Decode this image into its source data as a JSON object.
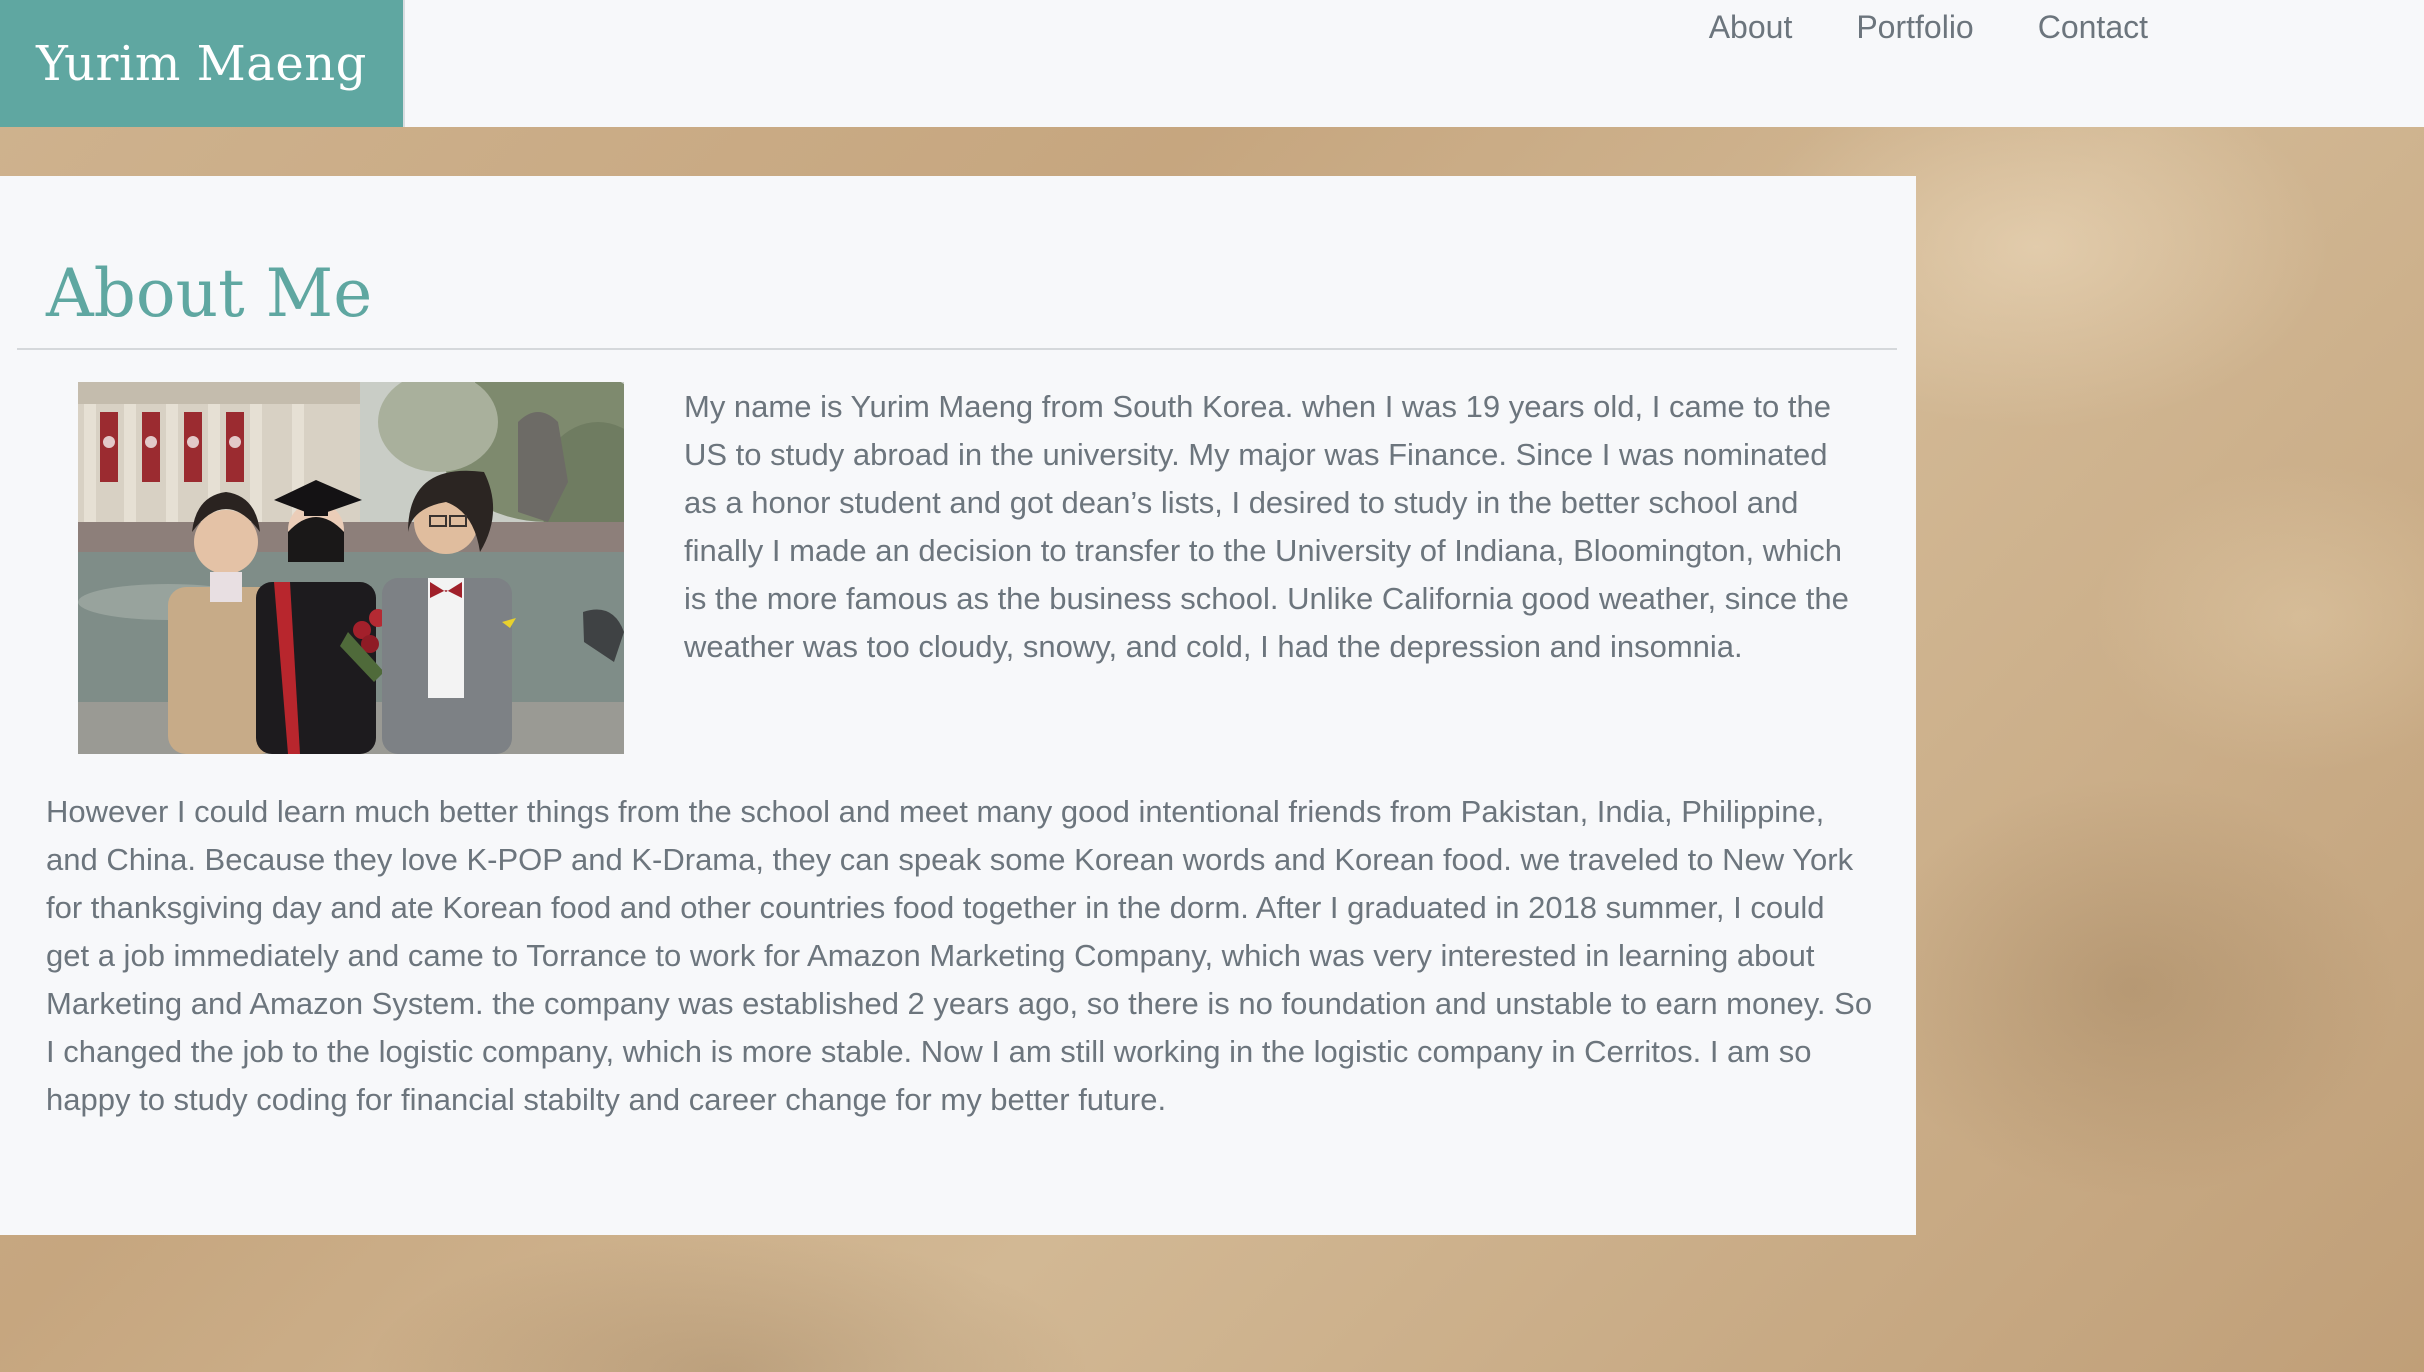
{
  "header": {
    "brand": "Yurim Maeng",
    "nav": [
      "About",
      "Portfolio",
      "Contact"
    ]
  },
  "about": {
    "title": "About Me",
    "photo_icon": "graduation-family-photo",
    "paragraph_1": "My name is Yurim Maeng from South Korea. when I was 19 years old, I came to the US to study abroad in the university. My major was Finance. Since I was nominated as a honor student and got dean’s lists, I desired to study in the better school and finally I made an decision to transfer to the University of Indiana, Bloomington, which is the more famous as the business school. Unlike California good weather, since the weather was too cloudy, snowy, and cold, I had the depression and insomnia.",
    "paragraph_2": "However I could learn much better things from the school and meet many good intentional friends from Pakistan, India, Philippine, and China. Because they love K-POP and K-Drama, they can speak some Korean words and Korean food. we traveled to New York for thanksgiving day and ate Korean food and other countries food together in the dorm. After I graduated in 2018 summer, I could get a job immediately and came to Torrance to work for Amazon Marketing Company, which was very interested in learning about Marketing and Amazon System. the company was established 2 years ago, so there is no foundation and unstable to earn money. So I changed the job to the logistic company, which is more stable. Now I am still working in the logistic company in Cerritos. I am so happy to study coding for financial stabilty and career change for my better future."
  },
  "colors": {
    "accent": "#5fa7a1",
    "text": "#6c757d",
    "panel": "#f7f8fa"
  }
}
